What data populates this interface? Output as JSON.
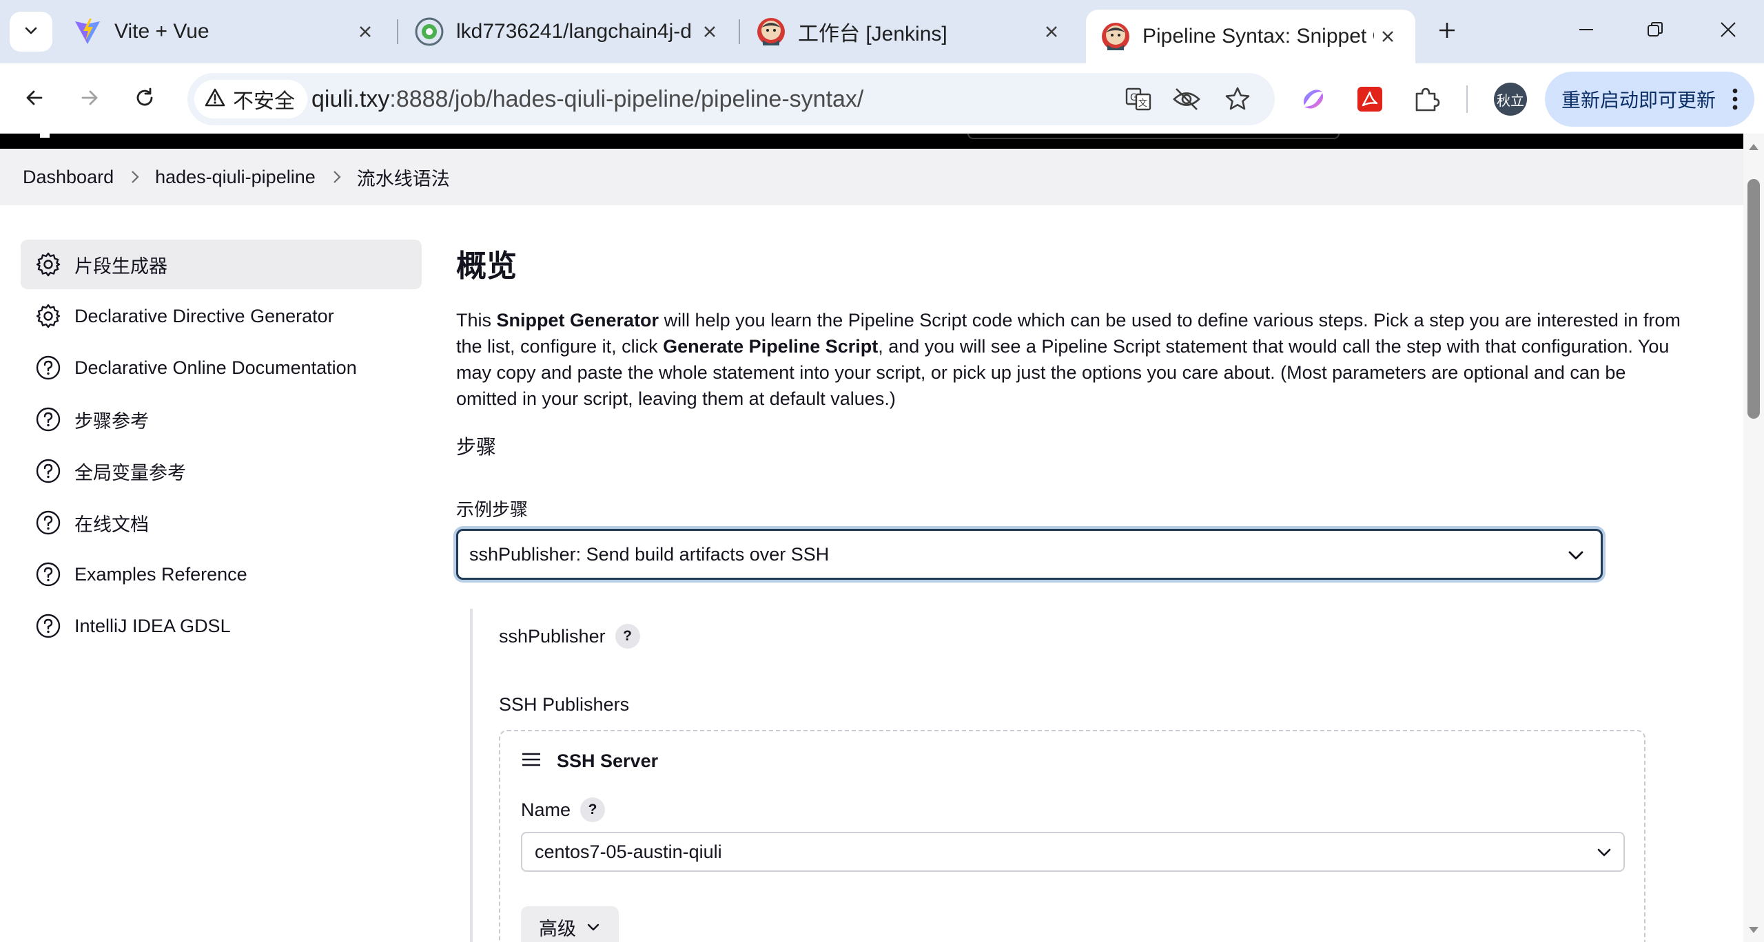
{
  "browser": {
    "tabs": [
      {
        "title": "Vite + Vue",
        "icon": "vite-icon",
        "active": false
      },
      {
        "title": "lkd7736241/langchain4j-d",
        "icon": "gitee-icon",
        "active": false
      },
      {
        "title": "工作台 [Jenkins]",
        "icon": "jenkins-icon",
        "active": false
      },
      {
        "title": "Pipeline Syntax: Snippet G",
        "icon": "jenkins-icon",
        "active": true
      }
    ],
    "security_label": "不安全",
    "url_host": "qiuli.txy",
    "url_rest": ":8888/job/hades-qiuli-pipeline/pipeline-syntax/",
    "profile_label": "秋立",
    "update_label": "重新启动即可更新",
    "accent_color": "#d3e3fd"
  },
  "breadcrumbs": [
    "Dashboard",
    "hades-qiuli-pipeline",
    "流水线语法"
  ],
  "sidebar": {
    "items": [
      {
        "label": "片段生成器",
        "icon": "gear-icon",
        "active": true
      },
      {
        "label": "Declarative Directive Generator",
        "icon": "gear-icon",
        "active": false
      },
      {
        "label": "Declarative Online Documentation",
        "icon": "help-circle-icon",
        "active": false
      },
      {
        "label": "步骤参考",
        "icon": "help-circle-icon",
        "active": false
      },
      {
        "label": "全局变量参考",
        "icon": "help-circle-icon",
        "active": false
      },
      {
        "label": "在线文档",
        "icon": "help-circle-icon",
        "active": false
      },
      {
        "label": "Examples Reference",
        "icon": "help-circle-icon",
        "active": false
      },
      {
        "label": "IntelliJ IDEA GDSL",
        "icon": "help-circle-icon",
        "active": false
      }
    ]
  },
  "main": {
    "title": "概览",
    "intro": {
      "p1": "This ",
      "b1": "Snippet Generator",
      "p2": " will help you learn the Pipeline Script code which can be used to define various steps. Pick a step you are interested in from the list, configure it, click ",
      "b2": "Generate Pipeline Script",
      "p3": ", and you will see a Pipeline Script statement that would call the step with that configuration. You may copy and paste the whole statement into your script, or pick up just the options you care about. (Most parameters are optional and can be omitted in your script, leaving them at default values.)"
    },
    "steps_title": "步骤",
    "sample_step_label": "示例步骤",
    "sample_step_value": "sshPublisher: Send build artifacts over SSH",
    "step_name": "sshPublisher",
    "help_glyph": "?",
    "ssh_publishers_label": "SSH Publishers",
    "server_title": "SSH Server",
    "name_label": "Name",
    "name_value": "centos7-05-austin-qiuli",
    "advanced_label": "高级"
  }
}
